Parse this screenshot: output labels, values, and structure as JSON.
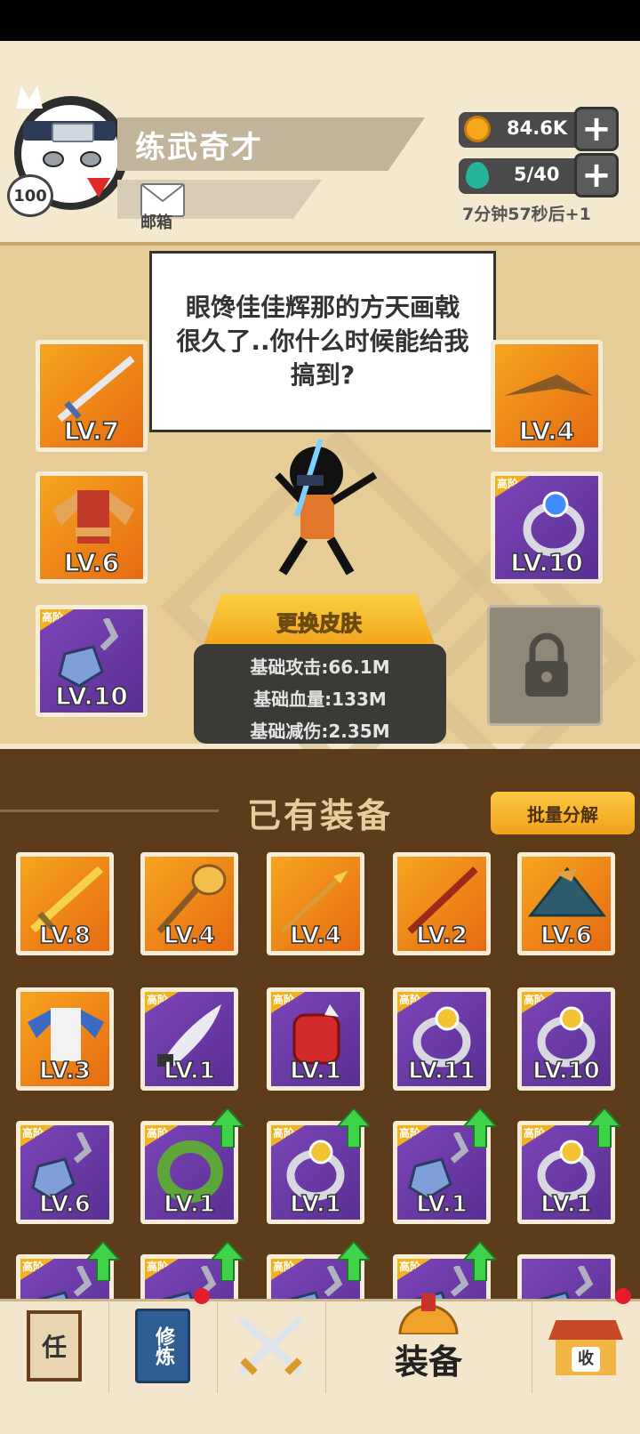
{
  "player": {
    "name": "练武奇才",
    "level": "100",
    "mail_label": "邮箱"
  },
  "resources": {
    "coins": "84.6K",
    "energy": "5/40",
    "energy_timer": "7分钟57秒后+1"
  },
  "dialog": {
    "text": "眼馋佳佳辉那的方天画戟很久了..你什么时候能给我搞到?"
  },
  "equipped": {
    "left": [
      {
        "level": "LV.7",
        "icon": "sword-icon",
        "tier": ""
      },
      {
        "level": "LV.6",
        "icon": "armor-icon",
        "tier": ""
      },
      {
        "level": "LV.10",
        "icon": "necklace-icon",
        "tier": "高阶"
      }
    ],
    "right": [
      {
        "level": "LV.4",
        "icon": "headband-icon",
        "tier": ""
      },
      {
        "level": "LV.10",
        "icon": "ring-icon",
        "tier": "高阶"
      }
    ],
    "locked_icon": "lock-icon"
  },
  "character": {
    "change_skin_label": "更换皮肤",
    "stats": [
      "基础攻击:66.1M",
      "基础血量:133M",
      "基础减伤:2.35M"
    ]
  },
  "inventory": {
    "title": "已有装备",
    "batch_button": "批量分解",
    "rows": [
      [
        {
          "level": "LV.8",
          "icon": "sword-icon",
          "tier": "",
          "upgrade": false
        },
        {
          "level": "LV.4",
          "icon": "mace-icon",
          "tier": "",
          "upgrade": false
        },
        {
          "level": "LV.4",
          "icon": "spear-icon",
          "tier": "",
          "upgrade": false
        },
        {
          "level": "LV.2",
          "icon": "staff-icon",
          "tier": "",
          "upgrade": false
        },
        {
          "level": "LV.6",
          "icon": "hat-icon",
          "tier": "",
          "upgrade": false
        }
      ],
      [
        {
          "level": "LV.3",
          "icon": "robe-icon",
          "tier": "",
          "upgrade": false
        },
        {
          "level": "LV.1",
          "icon": "blade-icon",
          "tier": "高阶",
          "upgrade": false
        },
        {
          "level": "LV.1",
          "icon": "gauntlet-icon",
          "tier": "高阶",
          "upgrade": false
        },
        {
          "level": "LV.11",
          "icon": "ring-icon",
          "tier": "高阶",
          "upgrade": false
        },
        {
          "level": "LV.10",
          "icon": "ring-icon",
          "tier": "高阶",
          "upgrade": false
        }
      ],
      [
        {
          "level": "LV.6",
          "icon": "necklace-icon",
          "tier": "高阶",
          "upgrade": false
        },
        {
          "level": "LV.1",
          "icon": "bracelet-icon",
          "tier": "高阶",
          "upgrade": true
        },
        {
          "level": "LV.1",
          "icon": "ring-icon",
          "tier": "高阶",
          "upgrade": true
        },
        {
          "level": "LV.1",
          "icon": "necklace-icon",
          "tier": "高阶",
          "upgrade": true
        },
        {
          "level": "LV.1",
          "icon": "ring-icon",
          "tier": "高阶",
          "upgrade": true
        }
      ],
      [
        {
          "level": "",
          "icon": "necklace-icon",
          "tier": "高阶",
          "upgrade": true
        },
        {
          "level": "",
          "icon": "necklace-icon",
          "tier": "高阶",
          "upgrade": true
        },
        {
          "level": "",
          "icon": "necklace-icon",
          "tier": "高阶",
          "upgrade": true
        },
        {
          "level": "",
          "icon": "necklace-icon",
          "tier": "高阶",
          "upgrade": true
        },
        {
          "level": "",
          "icon": "necklace-icon",
          "tier": "",
          "upgrade": false
        }
      ]
    ]
  },
  "bottom_nav": {
    "quest_glyph": "任",
    "training_glyphs": "修炼",
    "equipment_label": "装备",
    "collection_glyph": "收"
  },
  "colors": {
    "orange_slot": "#f28a1a",
    "purple_slot": "#6a3aa6",
    "tier_badge": "#f3b21b",
    "upgrade_arrow": "#3fd34a",
    "notification_dot": "#e41c2b"
  }
}
